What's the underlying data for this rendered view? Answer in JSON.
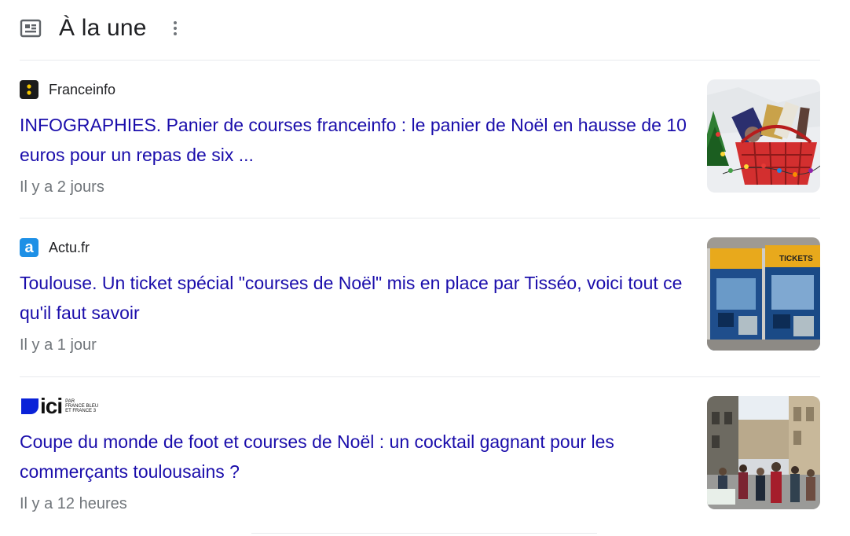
{
  "header": {
    "title": "À la une",
    "icon": "newspaper-icon",
    "menu_icon": "more-vert-icon"
  },
  "articles": [
    {
      "source": "Franceinfo",
      "favicon": "franceinfo-icon",
      "headline": "INFOGRAPHIES. Panier de courses franceinfo : le panier de Noël en hausse de 10 euros pour un repas de six ...",
      "time": "Il y a 2 jours",
      "thumbnail": "christmas-basket-image"
    },
    {
      "source": "Actu.fr",
      "favicon": "actu-fr-icon",
      "favicon_letter": "a",
      "headline": "Toulouse. Un ticket spécial \"courses de Noël\" mis en place par Tisséo, voici tout ce qu'il faut savoir",
      "time": "Il y a 1 jour",
      "thumbnail": "ticket-machines-image",
      "thumb_text": "TICKETS"
    },
    {
      "source": "ici par France Bleu et France 3",
      "logo_main": "ici",
      "logo_small": [
        "PAR",
        "FRANCE BLEU",
        "ET FRANCE 3"
      ],
      "favicon": "ici-logo-icon",
      "headline": "Coupe du monde de foot et courses de Noël : un cocktail gagnant pour les commerçants toulousains ?",
      "time": "Il y a 12 heures",
      "thumbnail": "shopping-street-image"
    }
  ],
  "colors": {
    "link": "#1a0dab",
    "meta": "#70757a",
    "divider": "#e8eaed",
    "actu_blue": "#1e90e6",
    "ici_blue": "#0a22d8"
  }
}
